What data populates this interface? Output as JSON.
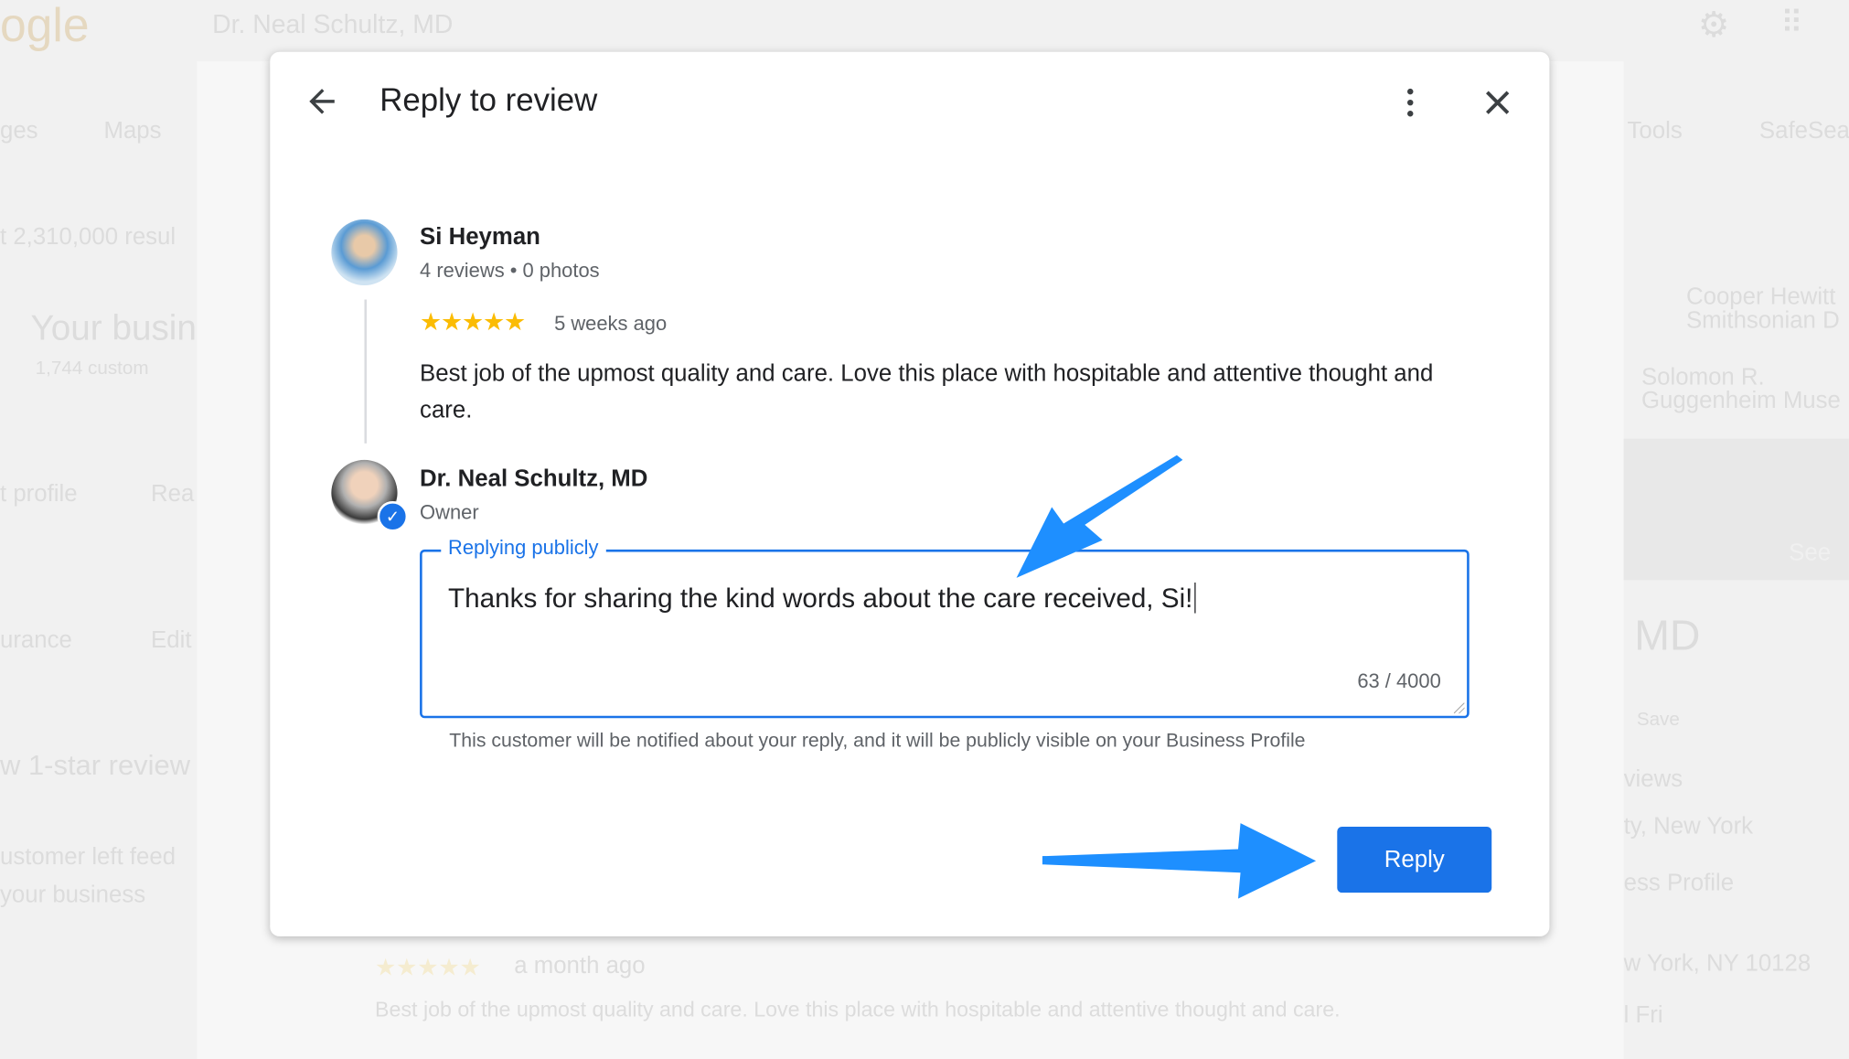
{
  "background": {
    "logo": "ogle",
    "search_query": "Dr. Neal Schultz, MD",
    "tabs": [
      "ges",
      "Maps",
      "Tools",
      "SafeSea"
    ],
    "results_count": "t 2,310,000 resul",
    "business_heading": "Your busin",
    "customers": "1,744 custom",
    "left_labels": [
      "t profile",
      "Rea",
      "urance",
      "Edit"
    ],
    "review_heading": "w 1-star review",
    "feedback": [
      "ustomer left feed",
      "your business"
    ],
    "map_labels": [
      "Cooper Hewitt",
      "Smithsonian D",
      "Solomon R.",
      "Guggenheim Muse"
    ],
    "see_button": "See",
    "panel_title": "MD",
    "save_button": "Save",
    "reviews": "views",
    "location": "ty, New York",
    "profile": "ess Profile",
    "address": "w York, NY 10128",
    "hours": "l Fri",
    "older_review_time": "a month ago",
    "older_review_text": "Best job of the upmost quality and care. Love this place with hospitable and attentive thought and care."
  },
  "dialog": {
    "title": "Reply to review",
    "review": {
      "author": "Si Heyman",
      "meta": "4 reviews • 0 photos",
      "rating": 5,
      "time": "5 weeks ago",
      "text": "Best job of the upmost quality and care. Love this place with hospitable and attentive thought and care."
    },
    "owner": {
      "name": "Dr. Neal Schultz, MD",
      "role": "Owner"
    },
    "reply_field": {
      "label": "Replying publicly",
      "value": "Thanks for sharing the kind words about the care received, Si!",
      "counter": "63 / 4000"
    },
    "notice": "This customer will be notified about your reply, and it will be publicly visible on your Business Profile",
    "reply_button": "Reply"
  },
  "colors": {
    "accent": "#1a73e8",
    "star": "#fbbc04",
    "arrow": "#1e8fff"
  }
}
